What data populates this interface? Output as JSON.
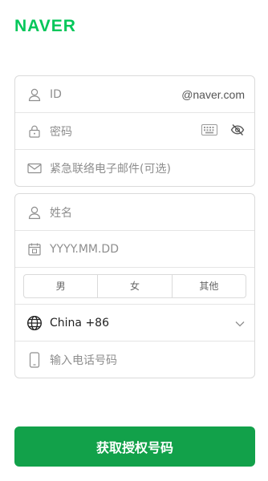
{
  "brand": {
    "logo": "NAVER",
    "color": "#03c75a"
  },
  "account": {
    "id_placeholder": "ID",
    "id_suffix": "@naver.com",
    "password_placeholder": "密码",
    "email_placeholder": "紧急联络电子邮件(可选)"
  },
  "profile": {
    "name_placeholder": "姓名",
    "birth_placeholder": "YYYY.MM.DD",
    "gender_options": [
      "男",
      "女",
      "其他"
    ],
    "country": "China +86",
    "phone_placeholder": "输入电话号码"
  },
  "cta": {
    "label": "获取授权号码",
    "color": "#12a14a"
  },
  "icons": {
    "id": "person-icon",
    "password": "lock-icon",
    "keyboard": "keyboard-icon",
    "visibility": "eye-slash-icon",
    "email": "envelope-icon",
    "name": "person-icon",
    "birth": "calendar-icon",
    "country": "globe-icon",
    "dropdown": "chevron-down-icon",
    "phone": "phone-icon"
  }
}
